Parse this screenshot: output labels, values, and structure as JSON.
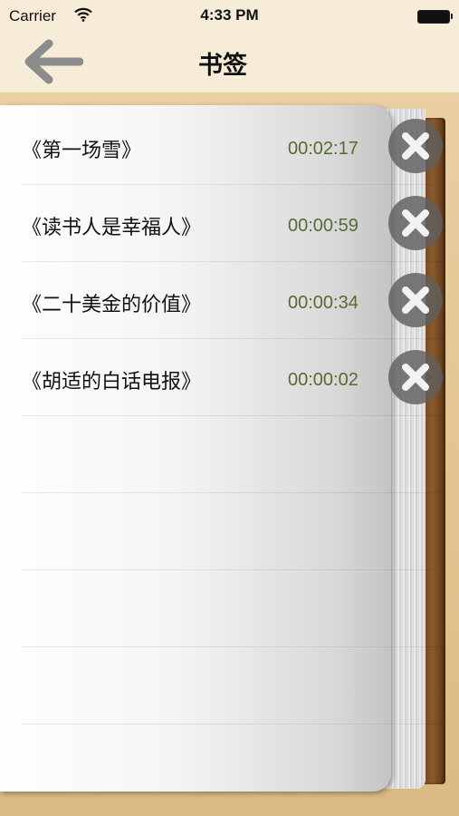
{
  "status_bar": {
    "carrier": "Carrier",
    "time": "4:33 PM",
    "wifi_icon": "wifi-icon",
    "battery_icon": "battery-full-icon"
  },
  "nav": {
    "title": "书签",
    "back_icon": "arrow-left-icon"
  },
  "bookmarks": [
    {
      "title": "《第一场雪》",
      "time": "00:02:17",
      "delete_icon": "close-icon"
    },
    {
      "title": "《读书人是幸福人》",
      "time": "00:00:59",
      "delete_icon": "close-icon"
    },
    {
      "title": "《二十美金的价值》",
      "time": "00:00:34",
      "delete_icon": "close-icon"
    },
    {
      "title": "《胡适的白话电报》",
      "time": "00:00:02",
      "delete_icon": "close-icon"
    }
  ],
  "colors": {
    "background": "#f3e7cf",
    "time_text": "#556b2f",
    "back_arrow": "#8c8c8c",
    "book_spine": "#7a4b22"
  }
}
